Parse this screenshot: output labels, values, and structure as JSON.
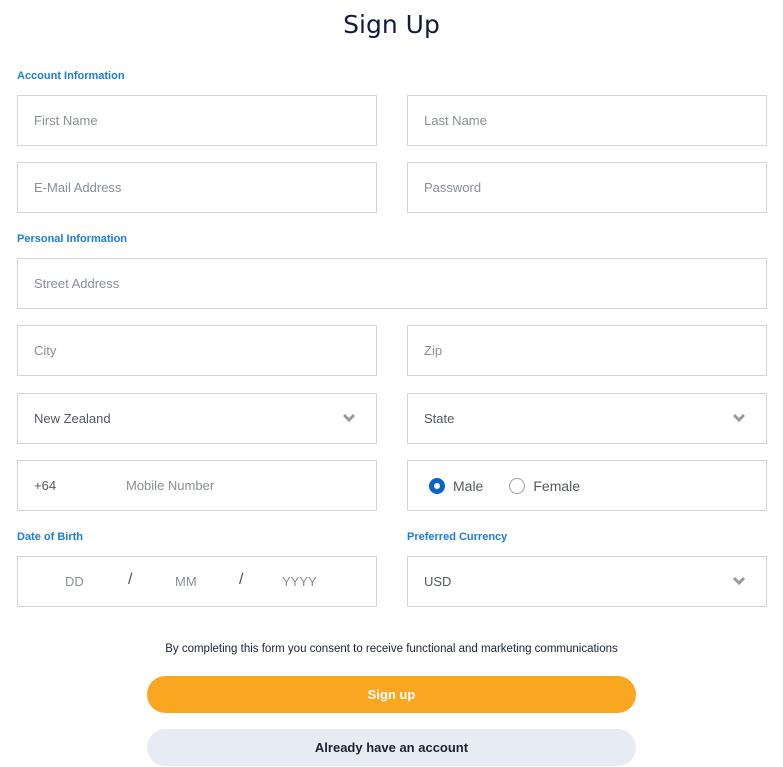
{
  "title": "Sign Up",
  "sections": {
    "account": "Account Information",
    "personal": "Personal Information",
    "dob": "Date of Birth",
    "currency": "Preferred Currency"
  },
  "fields": {
    "first_name": "First Name",
    "last_name": "Last Name",
    "email": "E-Mail Address",
    "password": "Password",
    "street": "Street Address",
    "city": "City",
    "zip": "Zip",
    "country": "New Zealand",
    "state": "State",
    "phone_prefix": "+64",
    "mobile": "Mobile Number"
  },
  "gender": {
    "options": [
      "Male",
      "Female"
    ],
    "selected": "Male"
  },
  "dob": {
    "day": "DD",
    "month": "MM",
    "year": "YYYY",
    "separator": "/"
  },
  "currency": "USD",
  "consent": "By completing this form you consent to receive functional and marketing communications",
  "buttons": {
    "signup": "Sign up",
    "login": "Already have an account"
  },
  "colors": {
    "accent": "#1a7de0",
    "primary_button": "#f9a621",
    "secondary_button": "#e6ebf4",
    "radio_selected": "#0b63c9"
  }
}
